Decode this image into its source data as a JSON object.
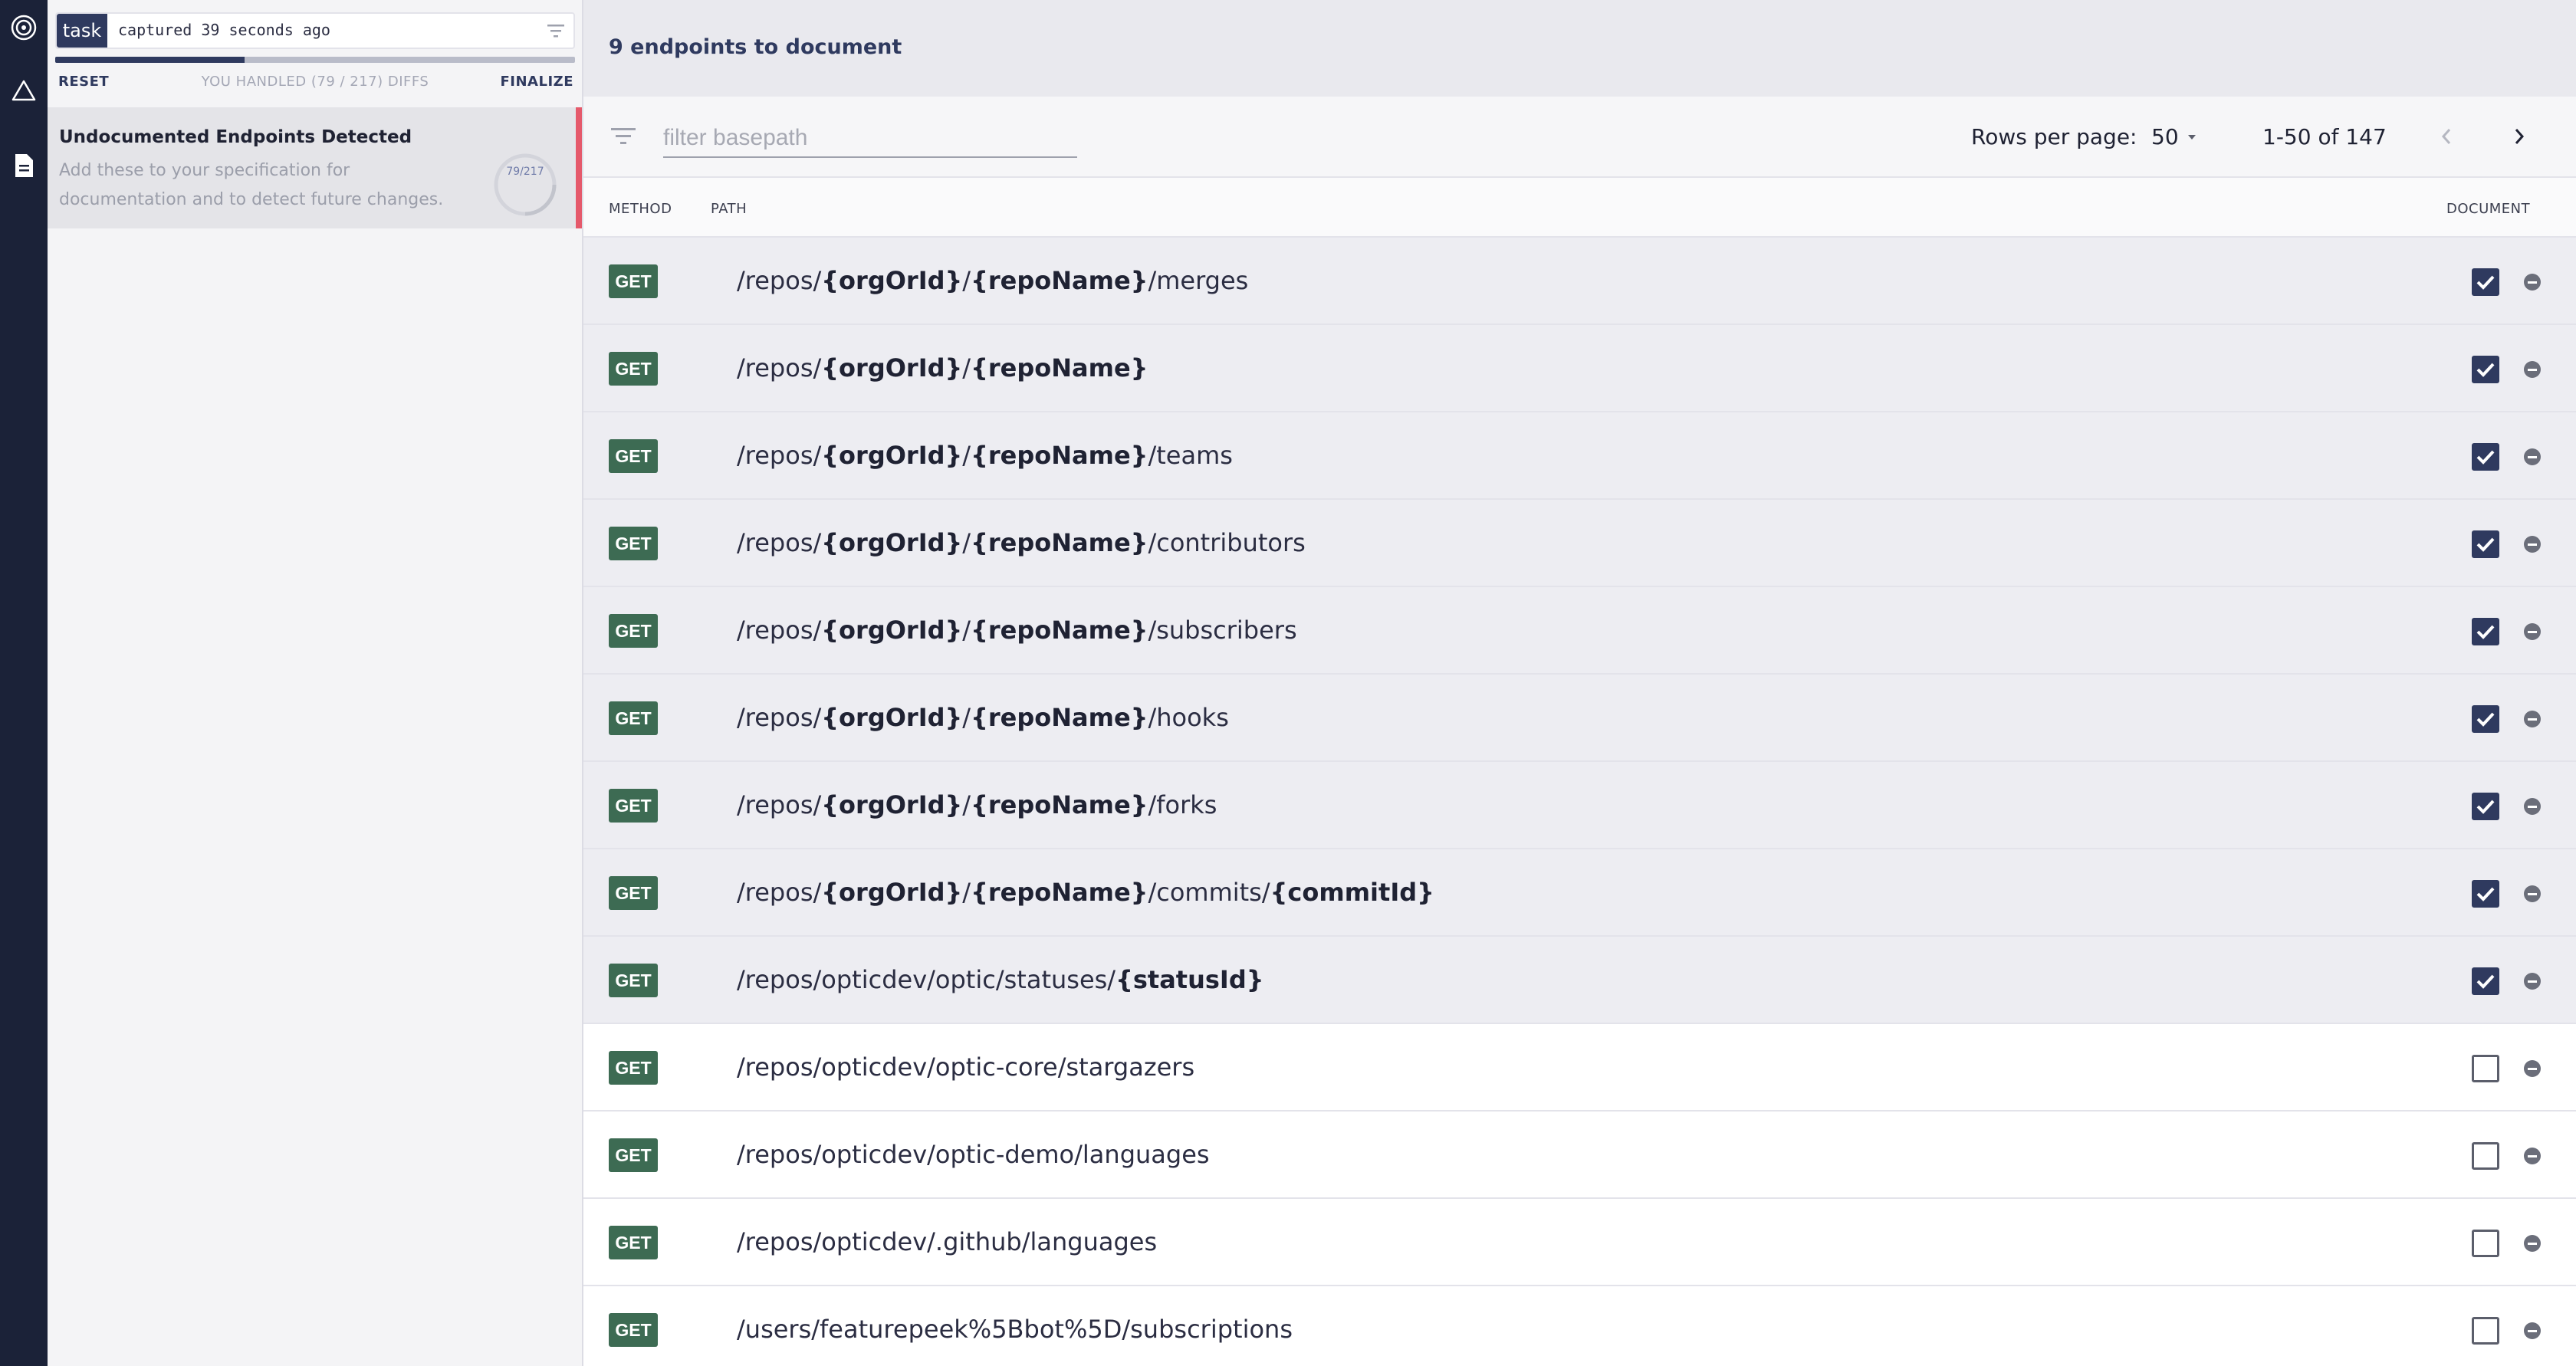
{
  "sidebar_rail": {
    "icons": [
      "optic-logo-icon",
      "warning-triangle-icon",
      "document-icon"
    ]
  },
  "left_panel": {
    "task_tag": "task",
    "captured_text": "captured 39 seconds ago",
    "progress_fraction": 0.364,
    "reset_label": "RESET",
    "handled_text": "YOU HANDLED (79 / 217) DIFFS",
    "finalize_label": "FINALIZE",
    "diff_card": {
      "title": "Undocumented Endpoints Detected",
      "description": "Add these to your specification for documentation and to detect future changes.",
      "counter": "79/217"
    }
  },
  "main": {
    "header_title": "9 endpoints to document",
    "filter_placeholder": "filter basepath",
    "rows_per_page_label": "Rows per page:",
    "rows_per_page_value": "50",
    "range_text": "1-50 of 147",
    "columns": {
      "method": "METHOD",
      "path": "PATH",
      "document": "DOCUMENT"
    }
  },
  "endpoints": [
    {
      "method": "GET",
      "segments": [
        [
          "/repos/",
          false
        ],
        [
          "{orgOrId}",
          true
        ],
        [
          "/",
          false
        ],
        [
          "{repoName}",
          true
        ],
        [
          "/merges",
          false
        ]
      ],
      "documented": true
    },
    {
      "method": "GET",
      "segments": [
        [
          "/repos/",
          false
        ],
        [
          "{orgOrId}",
          true
        ],
        [
          "/",
          false
        ],
        [
          "{repoName}",
          true
        ]
      ],
      "documented": true
    },
    {
      "method": "GET",
      "segments": [
        [
          "/repos/",
          false
        ],
        [
          "{orgOrId}",
          true
        ],
        [
          "/",
          false
        ],
        [
          "{repoName}",
          true
        ],
        [
          "/teams",
          false
        ]
      ],
      "documented": true
    },
    {
      "method": "GET",
      "segments": [
        [
          "/repos/",
          false
        ],
        [
          "{orgOrId}",
          true
        ],
        [
          "/",
          false
        ],
        [
          "{repoName}",
          true
        ],
        [
          "/contributors",
          false
        ]
      ],
      "documented": true
    },
    {
      "method": "GET",
      "segments": [
        [
          "/repos/",
          false
        ],
        [
          "{orgOrId}",
          true
        ],
        [
          "/",
          false
        ],
        [
          "{repoName}",
          true
        ],
        [
          "/subscribers",
          false
        ]
      ],
      "documented": true
    },
    {
      "method": "GET",
      "segments": [
        [
          "/repos/",
          false
        ],
        [
          "{orgOrId}",
          true
        ],
        [
          "/",
          false
        ],
        [
          "{repoName}",
          true
        ],
        [
          "/hooks",
          false
        ]
      ],
      "documented": true
    },
    {
      "method": "GET",
      "segments": [
        [
          "/repos/",
          false
        ],
        [
          "{orgOrId}",
          true
        ],
        [
          "/",
          false
        ],
        [
          "{repoName}",
          true
        ],
        [
          "/forks",
          false
        ]
      ],
      "documented": true
    },
    {
      "method": "GET",
      "segments": [
        [
          "/repos/",
          false
        ],
        [
          "{orgOrId}",
          true
        ],
        [
          "/",
          false
        ],
        [
          "{repoName}",
          true
        ],
        [
          "/commits/",
          false
        ],
        [
          "{commitId}",
          true
        ]
      ],
      "documented": true
    },
    {
      "method": "GET",
      "segments": [
        [
          "/repos/opticdev/optic/statuses/",
          false
        ],
        [
          "{statusId}",
          true
        ]
      ],
      "documented": true
    },
    {
      "method": "GET",
      "segments": [
        [
          "/repos/opticdev/optic-core/stargazers",
          false
        ]
      ],
      "documented": false
    },
    {
      "method": "GET",
      "segments": [
        [
          "/repos/opticdev/optic-demo/languages",
          false
        ]
      ],
      "documented": false
    },
    {
      "method": "GET",
      "segments": [
        [
          "/repos/opticdev/.github/languages",
          false
        ]
      ],
      "documented": false
    },
    {
      "method": "GET",
      "segments": [
        [
          "/users/featurepeek%5Bbot%5D/subscriptions",
          false
        ]
      ],
      "documented": false
    }
  ],
  "colors": {
    "rail": "#1b2238",
    "accent": "#2f3a5f",
    "get_badge": "#3d6b53",
    "diff_marker": "#e5596b"
  }
}
